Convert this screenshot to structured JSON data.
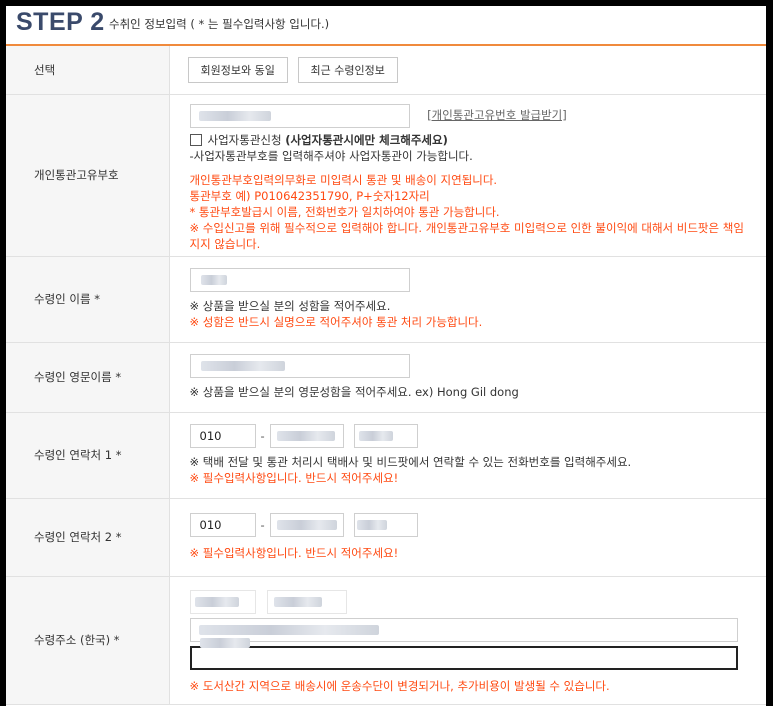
{
  "header": {
    "step": "STEP 2",
    "subtitle": "수취인 정보입력 ( * 는 필수입력사항 입니다.)"
  },
  "select_row": {
    "label": "선택",
    "btn_member": "회원정보와 동일",
    "btn_recent": "최근 수령인정보"
  },
  "customs_row": {
    "label": "개인통관고유부호",
    "link": "[개인통관고유번호 발급받기]",
    "checkbox_label": "사업자통관신청",
    "checkbox_bold": "(사업자통관시에만 체크해주세요)",
    "help": "-사업자통관부호를 입력해주셔야 사업자통관이 가능합니다.",
    "notes": [
      "개인통관부호입력의무화로 미입력시 통관 및 배송이 지연됩니다.",
      "통관부호 예) P010642351790, P+숫자12자리",
      "* 통관부호발급시 이름, 전화번호가 일치하여야 통관 가능합니다.",
      "※ 수입신고를 위해 필수적으로 입력해야 합니다. 개인통관고유부호 미입력으로 인한 불이익에 대해서 비드팟은 책임",
      "지지 않습니다."
    ]
  },
  "name_row": {
    "label": "수령인 이름 *",
    "help": "※ 상품을 받으실 분의 성함을 적어주세요.",
    "warn": "※ 성함은 반드시 실명으로 적어주셔야 통관 처리 가능합니다."
  },
  "ename_row": {
    "label": "수령인 영문이름 *",
    "help": "※ 상품을 받으실 분의 영문성함을 적어주세요. ex) Hong Gil dong"
  },
  "phone1_row": {
    "label": "수령인 연락처 1 *",
    "prefix": "010",
    "dash": "-",
    "help": "※ 택배 전달 및 통관 처리시 택배사 및 비드팟에서 연락할 수 있는 전화번호를 입력해주세요.",
    "warn": "※ 필수입력사항입니다. 반드시 적어주세요!"
  },
  "phone2_row": {
    "label": "수령인 연락처 2 *",
    "prefix": "010",
    "dash": "-",
    "warn": "※ 필수입력사항입니다. 반드시 적어주세요!"
  },
  "address_row": {
    "label": "수령주소 (한국) *",
    "warn": "※ 도서산간 지역으로 배송시에 운송수단이 변경되거나, 추가비용이 발생될 수 있습니다."
  },
  "colors": {
    "accent": "#f08a3c",
    "warn": "#ff4a12",
    "title": "#3a4a6b"
  }
}
